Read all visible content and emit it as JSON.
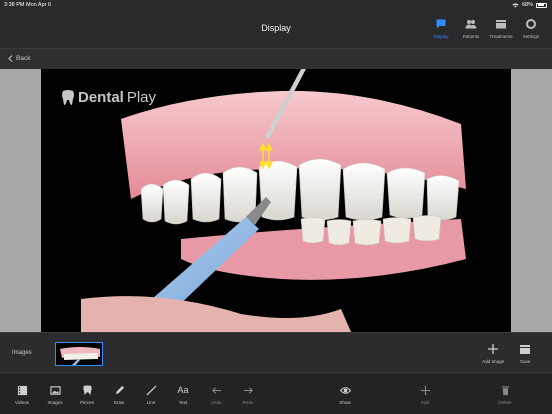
{
  "status_bar": {
    "time": "3:38 PM",
    "date": "Mon Apr 6",
    "battery": "68%"
  },
  "header": {
    "title": "Display",
    "nav": [
      {
        "label": "Display",
        "icon": "chat-bubble-icon",
        "active": true
      },
      {
        "label": "Patients",
        "icon": "people-icon",
        "active": false
      },
      {
        "label": "Treatments",
        "icon": "folders-icon",
        "active": false
      },
      {
        "label": "Settings",
        "icon": "gear-icon",
        "active": false
      }
    ]
  },
  "subbar": {
    "back_label": "Back"
  },
  "canvas": {
    "logo_bold": "Dental",
    "logo_thin": "Play"
  },
  "images_strip": {
    "label": "Images",
    "add_image": "Add Image",
    "save": "Save"
  },
  "toolbar": {
    "videos": "Videos",
    "images": "Images",
    "pieces": "Pieces",
    "draw": "Draw",
    "line": "Line",
    "text": "Text",
    "undo": "Undo",
    "redo": "Redo",
    "show": "Show",
    "add": "Add",
    "delete": "Delete",
    "text_glyph": "Aa"
  },
  "colors": {
    "accent": "#2f8bff",
    "background": "#1c1c1e"
  }
}
